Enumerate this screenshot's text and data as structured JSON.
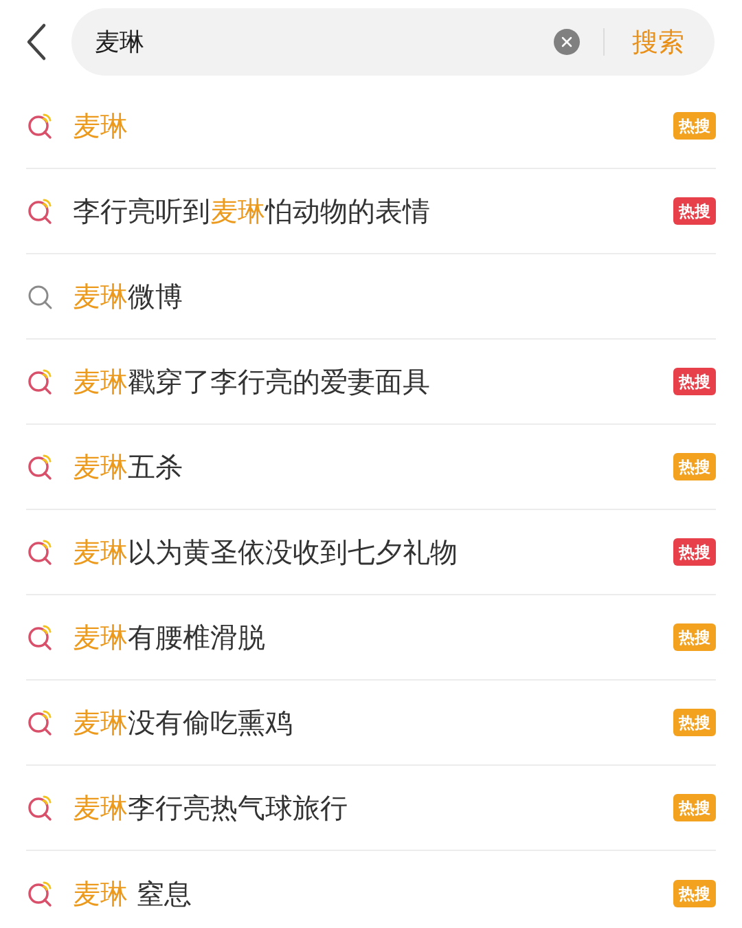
{
  "search_bar": {
    "value": "麦琳",
    "button": "搜索"
  },
  "suggestions": [
    {
      "kind": "hot",
      "segments": [
        {
          "text": "麦琳",
          "highlight": true
        }
      ],
      "badge": {
        "text": "热搜",
        "color": "#f3a21f"
      }
    },
    {
      "kind": "hot",
      "segments": [
        {
          "text": "李行亮听到",
          "highlight": false
        },
        {
          "text": "麦琳",
          "highlight": true
        },
        {
          "text": "怕动物的表情",
          "highlight": false
        }
      ],
      "badge": {
        "text": "热搜",
        "color": "#e8404a"
      }
    },
    {
      "kind": "plain",
      "segments": [
        {
          "text": "麦琳",
          "highlight": true
        },
        {
          "text": "微博",
          "highlight": false
        }
      ]
    },
    {
      "kind": "hot",
      "segments": [
        {
          "text": "麦琳",
          "highlight": true
        },
        {
          "text": "戳穿了李行亮的爱妻面具",
          "highlight": false
        }
      ],
      "badge": {
        "text": "热搜",
        "color": "#e8404a"
      }
    },
    {
      "kind": "hot",
      "segments": [
        {
          "text": "麦琳",
          "highlight": true
        },
        {
          "text": "五杀",
          "highlight": false
        }
      ],
      "badge": {
        "text": "热搜",
        "color": "#f3a21f"
      }
    },
    {
      "kind": "hot",
      "segments": [
        {
          "text": "麦琳",
          "highlight": true
        },
        {
          "text": "以为黄圣依没收到七夕礼物",
          "highlight": false
        }
      ],
      "badge": {
        "text": "热搜",
        "color": "#e8404a"
      }
    },
    {
      "kind": "hot",
      "segments": [
        {
          "text": "麦琳",
          "highlight": true
        },
        {
          "text": "有腰椎滑脱",
          "highlight": false
        }
      ],
      "badge": {
        "text": "热搜",
        "color": "#f3a21f"
      }
    },
    {
      "kind": "hot",
      "segments": [
        {
          "text": "麦琳",
          "highlight": true
        },
        {
          "text": "没有偷吃熏鸡",
          "highlight": false
        }
      ],
      "badge": {
        "text": "热搜",
        "color": "#f3a21f"
      }
    },
    {
      "kind": "hot",
      "segments": [
        {
          "text": "麦琳",
          "highlight": true
        },
        {
          "text": "李行亮热气球旅行",
          "highlight": false
        }
      ],
      "badge": {
        "text": "热搜",
        "color": "#f3a21f"
      }
    },
    {
      "kind": "hot",
      "segments": [
        {
          "text": "麦琳",
          "highlight": true
        },
        {
          "text": " 窒息",
          "highlight": false
        }
      ],
      "badge": {
        "text": "热搜",
        "color": "#f3a21f"
      }
    }
  ]
}
